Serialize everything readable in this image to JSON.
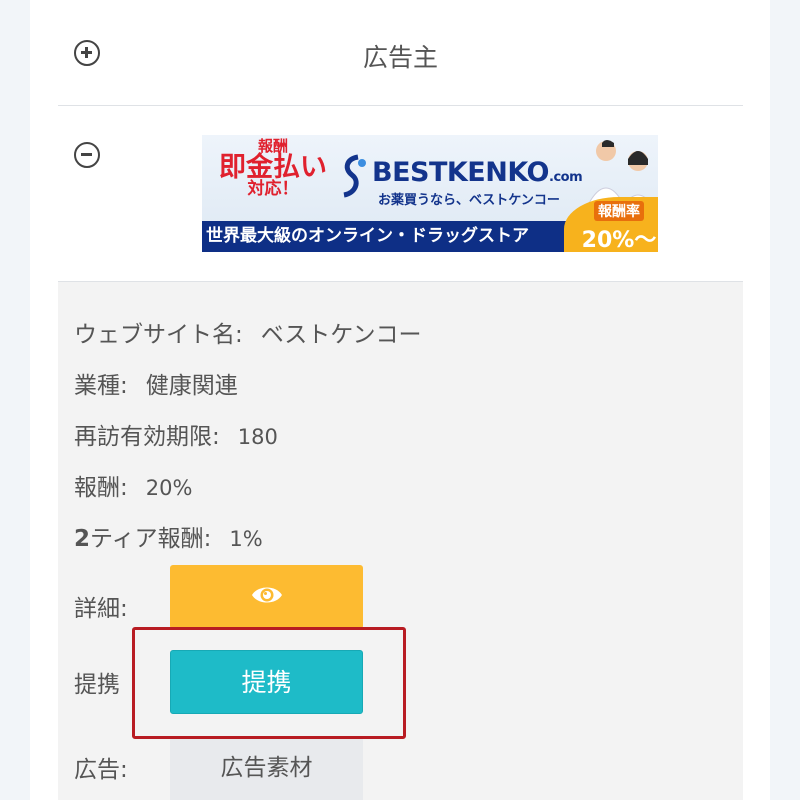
{
  "advertiser_row": {
    "title": "広告主",
    "toggle_icon": "plus-circle-icon"
  },
  "banner_row": {
    "toggle_icon": "minus-circle-icon",
    "banner": {
      "promo_line1": "報酬",
      "promo_line2": "即金払い",
      "promo_line3": "対応！",
      "brand": "BESTKENKO",
      "brand_suffix": ".com",
      "tagline": "お薬買うなら、ベストケンコー",
      "bottom_text": "世界最大級のオンライン・ドラッグストア",
      "rate_label": "報酬率",
      "rate_value": "20%〜",
      "colors": {
        "red": "#e0212e",
        "navy": "#0e2f86",
        "orange": "#f7b21d"
      }
    }
  },
  "details": {
    "site_label": "ウェブサイト名:",
    "site_value": "ベストケンコー",
    "industry_label": "業種:",
    "industry_value": "健康関連",
    "revisit_label": "再訪有効期限:",
    "revisit_value": "180",
    "reward_label": "報酬:",
    "reward_value": "20%",
    "tier_label_num": "2",
    "tier_label_text": "ティア報酬:",
    "tier_value": "1%",
    "detail_label": "詳細:",
    "detail_button_icon": "eye-icon",
    "partner_label": "提携",
    "partner_button": "提携",
    "ad_label": "広告:",
    "ad_button": "広告素材"
  },
  "colors": {
    "detail_button": "#fdbb31",
    "partner_button": "#1ebbc8",
    "highlight_border": "#b81b22"
  }
}
